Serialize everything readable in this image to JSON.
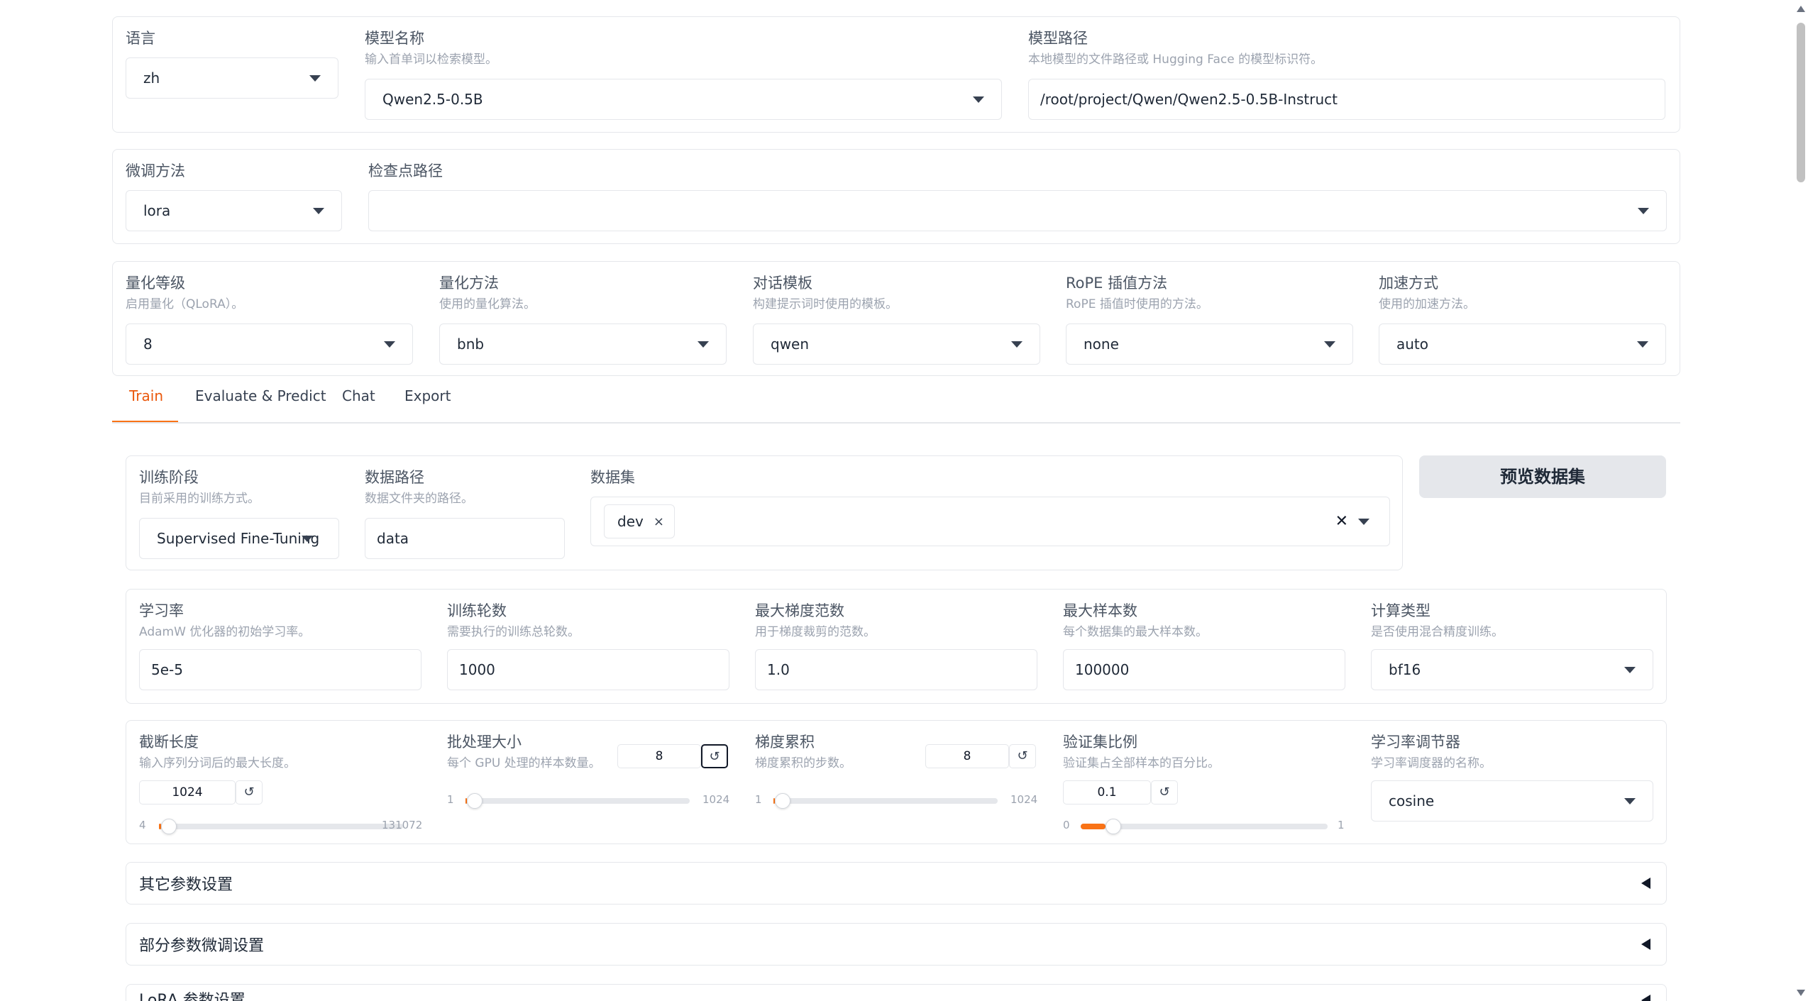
{
  "top": {
    "lang": {
      "label": "语言",
      "value": "zh"
    },
    "model_name": {
      "label": "模型名称",
      "info": "输入首单词以检索模型。",
      "value": "Qwen2.5-0.5B"
    },
    "model_path": {
      "label": "模型路径",
      "info": "本地模型的文件路径或 Hugging Face 的模型标识符。",
      "value": "/root/project/Qwen/Qwen2.5-0.5B-Instruct"
    }
  },
  "finetune": {
    "method": {
      "label": "微调方法",
      "value": "lora"
    },
    "checkpoint": {
      "label": "检查点路径",
      "value": ""
    }
  },
  "advanced": {
    "quant_bit": {
      "label": "量化等级",
      "info": "启用量化（QLoRA）。",
      "value": "8"
    },
    "quant_method": {
      "label": "量化方法",
      "info": "使用的量化算法。",
      "value": "bnb"
    },
    "template": {
      "label": "对话模板",
      "info": "构建提示词时使用的模板。",
      "value": "qwen"
    },
    "rope": {
      "label": "RoPE 插值方法",
      "info": "RoPE 插值时使用的方法。",
      "value": "none"
    },
    "booster": {
      "label": "加速方式",
      "info": "使用的加速方法。",
      "value": "auto"
    }
  },
  "tabs": [
    "Train",
    "Evaluate & Predict",
    "Chat",
    "Export"
  ],
  "train": {
    "stage": {
      "label": "训练阶段",
      "info": "目前采用的训练方式。",
      "value": "Supervised Fine-Tuning"
    },
    "dataset_dir": {
      "label": "数据路径",
      "info": "数据文件夹的路径。",
      "value": "data"
    },
    "dataset": {
      "label": "数据集",
      "chip": "dev",
      "chip_close": "×",
      "clear": "✕"
    },
    "preview_button": "预览数据集",
    "lr": {
      "label": "学习率",
      "info": "AdamW 优化器的初始学习率。",
      "value": "5e-5"
    },
    "epochs": {
      "label": "训练轮数",
      "info": "需要执行的训练总轮数。",
      "value": "1000"
    },
    "max_grad_norm": {
      "label": "最大梯度范数",
      "info": "用于梯度裁剪的范数。",
      "value": "1.0"
    },
    "max_samples": {
      "label": "最大样本数",
      "info": "每个数据集的最大样本数。",
      "value": "100000"
    },
    "compute_type": {
      "label": "计算类型",
      "info": "是否使用混合精度训练。",
      "value": "bf16"
    },
    "cutoff_len": {
      "label": "截断长度",
      "info": "输入序列分词后的最大长度。",
      "value": "1024",
      "min": "4",
      "max": "131072",
      "fraction": 0.0078
    },
    "batch_size": {
      "label": "批处理大小",
      "info": "每个 GPU 处理的样本数量。",
      "value": "8",
      "min": "1",
      "max": "1024",
      "fraction": 0.0068
    },
    "grad_accum": {
      "label": "梯度累积",
      "info": "梯度累积的步数。",
      "value": "8",
      "min": "1",
      "max": "1024",
      "fraction": 0.0068
    },
    "val_size": {
      "label": "验证集比例",
      "info": "验证集占全部样本的百分比。",
      "value": "0.1",
      "min": "0",
      "max": "1",
      "fraction": 0.1
    },
    "scheduler": {
      "label": "学习率调节器",
      "info": "学习率调度器的名称。",
      "value": "cosine"
    },
    "reset_glyph": "↺"
  },
  "accordions": [
    "其它参数设置",
    "部分参数微调设置",
    "LoRA 参数设置"
  ],
  "colors": {
    "accent": "#f97316",
    "tab_active": "#ea580c"
  }
}
